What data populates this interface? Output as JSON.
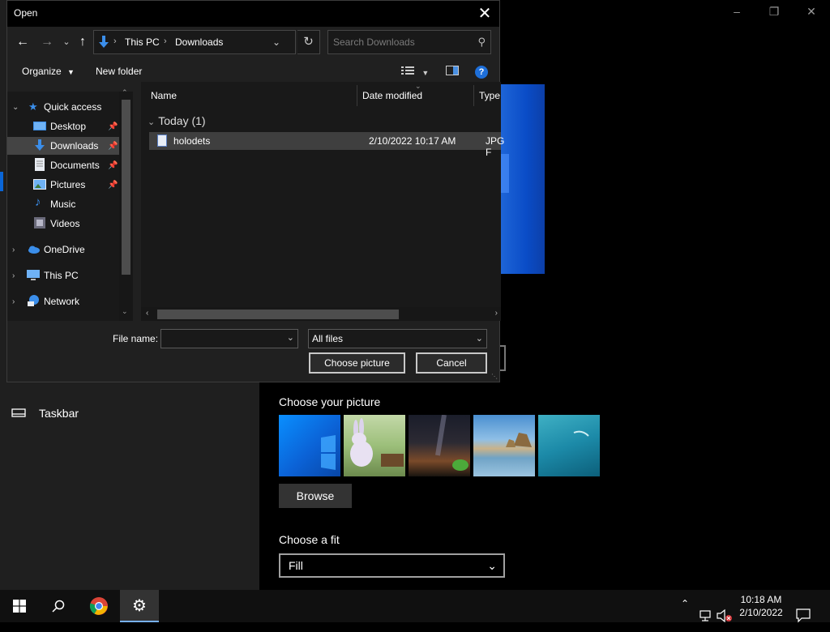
{
  "settings": {
    "taskbar_label": "Taskbar",
    "choose_picture_label": "Choose your picture",
    "browse_label": "Browse",
    "choose_fit_label": "Choose a fit",
    "fit_value": "Fill",
    "window_controls": [
      "minimize-icon",
      "restore-icon",
      "close-icon"
    ]
  },
  "dialog": {
    "title": "Open",
    "address": {
      "segments": [
        "This PC",
        "Downloads"
      ]
    },
    "search_placeholder": "Search Downloads",
    "toolbar": {
      "organize_label": "Organize",
      "new_folder_label": "New folder"
    },
    "nav": {
      "items": [
        {
          "label": "Quick access",
          "icon": "star-icon",
          "pinned": false,
          "expandable": true
        },
        {
          "label": "Desktop",
          "icon": "desktop-icon",
          "pinned": true
        },
        {
          "label": "Downloads",
          "icon": "download-icon",
          "pinned": true,
          "selected": true
        },
        {
          "label": "Documents",
          "icon": "documents-icon",
          "pinned": true
        },
        {
          "label": "Pictures",
          "icon": "pictures-icon",
          "pinned": true
        },
        {
          "label": "Music",
          "icon": "music-icon",
          "pinned": false
        },
        {
          "label": "Videos",
          "icon": "videos-icon",
          "pinned": false
        },
        {
          "label": "OneDrive",
          "icon": "cloud-icon",
          "expandable": true
        },
        {
          "label": "This PC",
          "icon": "computer-icon",
          "expandable": true
        },
        {
          "label": "Network",
          "icon": "network-icon",
          "expandable": true
        }
      ]
    },
    "columns": [
      "Name",
      "Date modified",
      "Type"
    ],
    "group_header": "Today (1)",
    "files": [
      {
        "name": "holodets",
        "date": "2/10/2022 10:17 AM",
        "type": "JPG F"
      }
    ],
    "file_name_label": "File name:",
    "file_name_value": "",
    "filter_value": "All files",
    "choose_button": "Choose picture",
    "cancel_button": "Cancel"
  },
  "taskbar": {
    "icons": [
      "start-icon",
      "search-icon",
      "chrome-icon",
      "settings-gear-icon"
    ],
    "clock_time": "10:18 AM",
    "clock_date": "2/10/2022"
  },
  "colors": {
    "accent": "#0a66d8",
    "dialog_bg": "#202020",
    "selection": "#444444"
  }
}
